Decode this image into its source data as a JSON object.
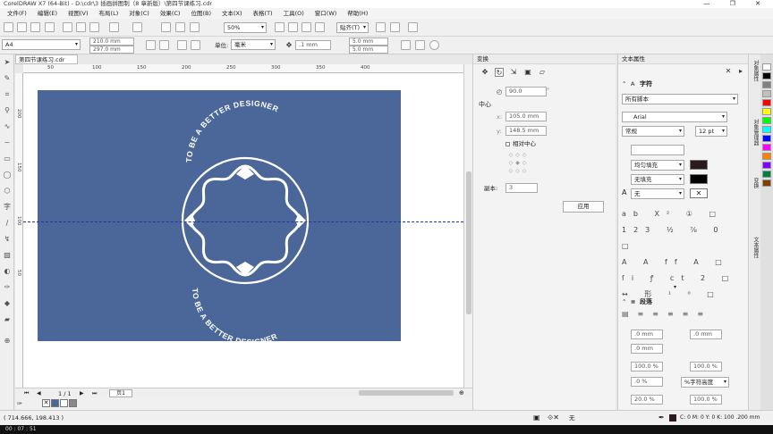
{
  "window": {
    "title": "CorelDRAW X7 (64-Bit) - D:\\cdr\\3 插画拼图制（8 章新版）\\第四节课练习.cdr",
    "controls": "— ❐ ✕"
  },
  "menu": [
    "文件(F)",
    "编辑(E)",
    "视图(V)",
    "布局(L)",
    "对象(C)",
    "效果(C)",
    "位图(B)",
    "文本(X)",
    "表格(T)",
    "工具(O)",
    "窗口(W)",
    "帮助(H)"
  ],
  "toolbar": {
    "zoom": "50%",
    "snap": "贴齐(T)"
  },
  "property_bar": {
    "paper": "A4",
    "width": "210.0 mm",
    "height": "297.0 mm",
    "units_label": "单位:",
    "units": "毫米",
    "nudge": ".1 mm",
    "dup_x": "5.0 mm",
    "dup_y": "5.0 mm"
  },
  "document": {
    "tab": "第四节课练习.cdr",
    "page_indicator": "1 / 1",
    "page_tab": "页1"
  },
  "ruler": {
    "h_ticks": [
      "50",
      "100",
      "150",
      "200",
      "250",
      "300",
      "350",
      "400"
    ],
    "v_ticks": [
      "200",
      "150",
      "100",
      "50"
    ]
  },
  "artwork": {
    "top_text": "TO BE A BETTER DESIGNER",
    "bottom_text": "TO BE A BETTER DESIGNER",
    "page_color": "#4b679a"
  },
  "transform": {
    "title": "变换",
    "angle": "90.0",
    "center_label": "中心",
    "x_label": "x:",
    "x": "105.0 mm",
    "y_label": "y:",
    "y": "148.5 mm",
    "relative_center": "相对中心",
    "copies_label": "副本:",
    "copies": "3",
    "apply": "应用"
  },
  "text_props": {
    "title": "文本属性",
    "char_section": "字符",
    "script": "所有脚本",
    "font": "Arial",
    "style": "常规",
    "size": "12 pt",
    "fill": "均匀填充",
    "bg_fill": "无填充",
    "outline": "无",
    "para_section": "段落",
    "indent1": ".0 mm",
    "indent2": ".0 mm",
    "indent3": ".0 mm",
    "spacing1": "100.0 %",
    "spacing2": "100.0 %",
    "spacing3": ".0 %",
    "char_height": "%字符高度",
    "word1": "20.0 %",
    "word2": "100.0 %"
  },
  "dockers": [
    "对象属性",
    "对象管理器",
    "变换",
    "文本属性"
  ],
  "status": {
    "coords": "( 714.666, 198.413 )",
    "fill": "无",
    "color": "C: 0 M: 0 Y: 0 K: 100  .200 mm"
  },
  "timer": "00 : 07 : 51",
  "palette": [
    "#ffffff",
    "#000000",
    "#808080",
    "#c0c0c0",
    "#ff0000",
    "#ffff00",
    "#00ff00",
    "#00ffff",
    "#0000ff",
    "#ff00ff",
    "#ff8000",
    "#8000ff",
    "#008040",
    "#804000"
  ]
}
